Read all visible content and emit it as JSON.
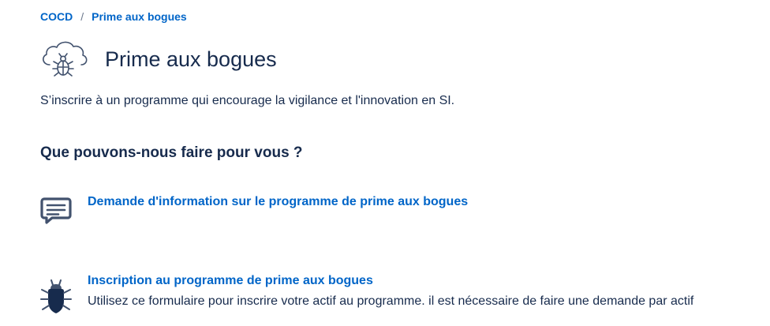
{
  "breadcrumb": {
    "root": "COCD",
    "separator": "/",
    "current": "Prime aux bogues"
  },
  "header": {
    "logo_icon": "cloud-bug-icon",
    "title": "Prime aux bogues"
  },
  "description": "S’inscrire à un programme qui encourage la vigilance et l'innovation en SI.",
  "section_title": "Que pouvons-nous faire pour vous ?",
  "request_types": [
    {
      "icon": "chat-message-icon",
      "title": "Demande d'information sur le programme de prime aux bogues",
      "description": ""
    },
    {
      "icon": "bug-icon",
      "title": "Inscription au programme de prime aux bogues",
      "description": "Utilisez ce formulaire pour inscrire votre actif au programme. il est nécessaire de faire une demande par actif"
    }
  ],
  "colors": {
    "link": "#0065c8",
    "text": "#172b4d",
    "icon": "#42526e"
  }
}
